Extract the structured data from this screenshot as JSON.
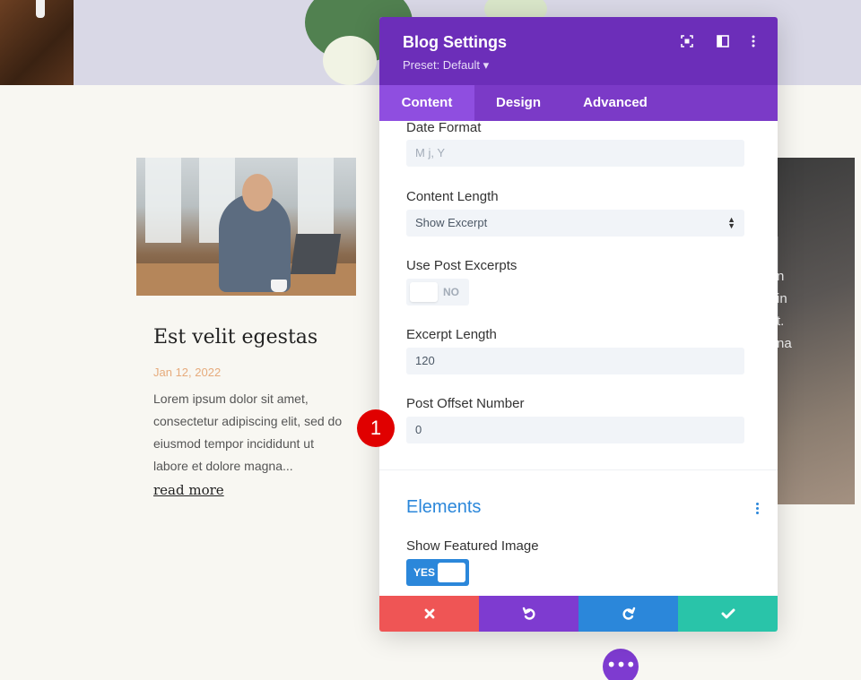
{
  "background": {
    "post": {
      "title": "Est velit egestas",
      "date": "Jan 12, 2022",
      "excerpt": "Lorem ipsum dolor sit amet, consectetur adipiscing elit, sed do eiusmod tempor incididunt ut labore et dolore magna...",
      "read_more": "read more"
    },
    "right_snippet": [
      "n",
      "in",
      "t.",
      "na"
    ],
    "fab_label": "•••"
  },
  "modal": {
    "title": "Blog Settings",
    "preset": "Preset: Default ▾",
    "header_icons": [
      "focus-icon",
      "sidebar-layout-icon",
      "more-vertical-icon"
    ],
    "tabs": [
      {
        "label": "Content",
        "active": true
      },
      {
        "label": "Design",
        "active": false
      },
      {
        "label": "Advanced",
        "active": false
      }
    ],
    "fields": {
      "date_format": {
        "label": "Date Format",
        "placeholder": "M j, Y"
      },
      "content_length": {
        "label": "Content Length",
        "value": "Show Excerpt"
      },
      "use_post_excerpts": {
        "label": "Use Post Excerpts",
        "value": "NO"
      },
      "excerpt_length": {
        "label": "Excerpt Length",
        "value": "120"
      },
      "post_offset": {
        "label": "Post Offset Number",
        "value": "0"
      }
    },
    "elements_section": {
      "title": "Elements",
      "show_featured_image": {
        "label": "Show Featured Image",
        "value": "YES"
      }
    },
    "footer_buttons": [
      {
        "name": "cancel",
        "color": "#ef5555"
      },
      {
        "name": "undo",
        "color": "#7e3bd0"
      },
      {
        "name": "redo",
        "color": "#2b87da"
      },
      {
        "name": "save",
        "color": "#29c4a9"
      }
    ]
  },
  "annotation": {
    "badge_number": "1",
    "color": "#e00000"
  },
  "colors": {
    "header_purple": "#6c2eb9",
    "tabs_purple": "#7b3ac7",
    "accent_blue": "#2b87da",
    "input_bg": "#f1f4f8"
  }
}
